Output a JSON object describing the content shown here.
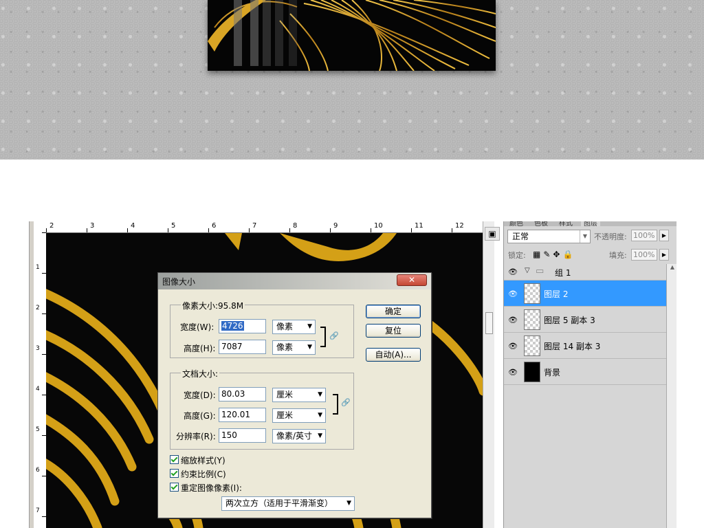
{
  "rulers": {
    "top": [
      "2",
      "3",
      "4",
      "5",
      "6",
      "7",
      "8",
      "9",
      "10",
      "11",
      "12"
    ],
    "left": [
      "1",
      "2",
      "3",
      "4",
      "5",
      "6",
      "7"
    ]
  },
  "layers_panel": {
    "tabs": [
      "颜色",
      "色板",
      "样式",
      "图层"
    ],
    "blend_mode": "正常",
    "opacity_label": "不透明度:",
    "opacity_value": "100%",
    "lock_label": "锁定:",
    "fill_label": "填充:",
    "fill_value": "100%",
    "group_name": "组 1",
    "layers": [
      {
        "name": "图层 2",
        "selected": true
      },
      {
        "name": "图层 5 副本 3",
        "selected": false
      },
      {
        "name": "图层 14 副本 3",
        "selected": false
      },
      {
        "name": "背景",
        "selected": false
      }
    ]
  },
  "dialog": {
    "title": "图像大小",
    "pixel_dims_label": "像素大小:95.8M",
    "pixel_width_label": "宽度(W):",
    "pixel_width_value": "4726",
    "pixel_width_unit": "像素",
    "pixel_height_label": "高度(H):",
    "pixel_height_value": "7087",
    "pixel_height_unit": "像素",
    "doc_size_label": "文档大小:",
    "doc_width_label": "宽度(D):",
    "doc_width_value": "80.03",
    "doc_width_unit": "厘米",
    "doc_height_label": "高度(G):",
    "doc_height_value": "120.01",
    "doc_height_unit": "厘米",
    "resolution_label": "分辨率(R):",
    "resolution_value": "150",
    "resolution_unit": "像素/英寸",
    "ok_button": "确定",
    "reset_button": "复位",
    "auto_button": "自动(A)...",
    "scale_styles": "缩放样式(Y)",
    "constrain_proportions": "约束比例(C)",
    "resample_image": "重定图像像素(I):",
    "resample_method": "两次立方（适用于平滑渐变）",
    "close_symbol": "✕"
  },
  "colors": {
    "gold": "#d4a017",
    "selection": "#3399ff"
  }
}
